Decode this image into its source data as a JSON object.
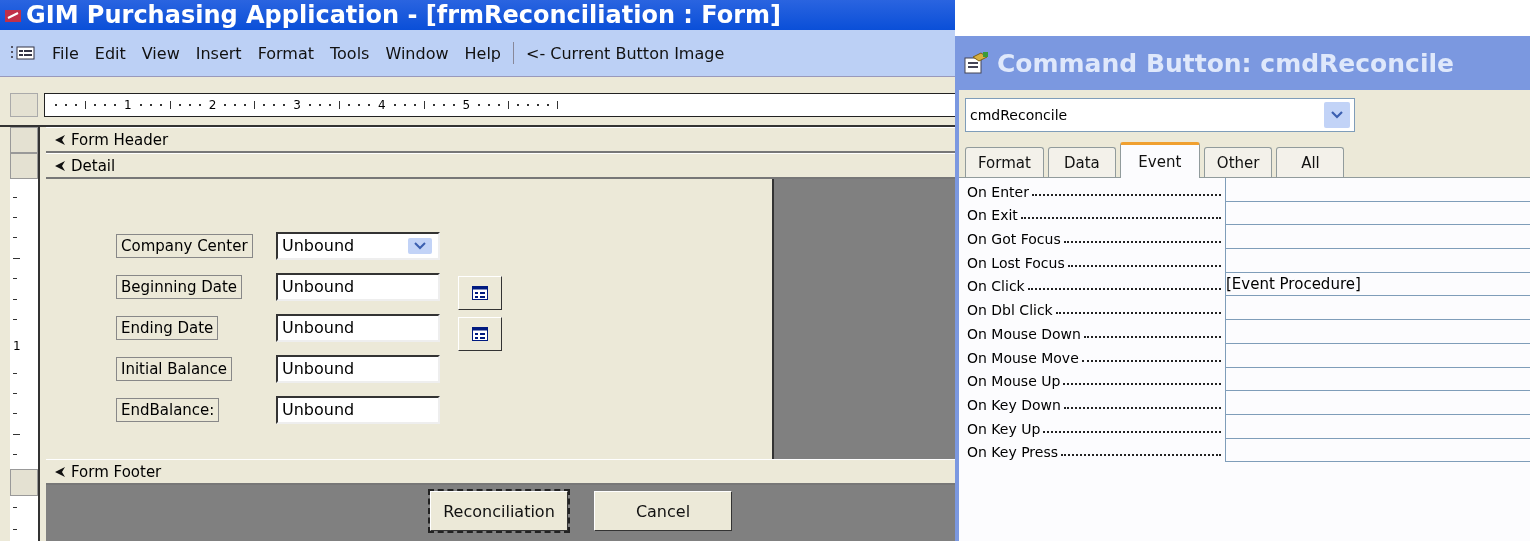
{
  "window": {
    "title": "GIM Purchasing Application - [frmReconciliation : Form]"
  },
  "menu": [
    {
      "label": "File"
    },
    {
      "label": "Edit"
    },
    {
      "label": "View"
    },
    {
      "label": "Insert"
    },
    {
      "label": "Format"
    },
    {
      "label": "Tools"
    },
    {
      "label": "Window"
    },
    {
      "label": "Help"
    }
  ],
  "toolbar_hint": "<- Current Button Image",
  "ruler": {
    "marks": [
      "1",
      "2",
      "3",
      "4",
      "5"
    ],
    "vertical_marks": [
      "1"
    ]
  },
  "sections": {
    "header": "Form Header",
    "detail": "Detail",
    "footer": "Form Footer"
  },
  "fields": [
    {
      "kind": "combo",
      "label": "Company Center",
      "value": "Unbound",
      "calendar": false
    },
    {
      "kind": "text",
      "label": "Beginning Date",
      "value": "Unbound",
      "calendar": true
    },
    {
      "kind": "text",
      "label": "Ending Date",
      "value": "Unbound",
      "calendar": true
    },
    {
      "kind": "text",
      "label": "Initial Balance",
      "value": "Unbound",
      "calendar": false
    },
    {
      "kind": "text",
      "label": "EndBalance:",
      "value": "Unbound",
      "calendar": false
    }
  ],
  "footer_buttons": [
    {
      "label": "Reconciliation",
      "selected": true
    },
    {
      "label": "Cancel",
      "selected": false
    }
  ],
  "property_sheet": {
    "title": "Command Button: cmdReconcile",
    "object": "cmdReconcile",
    "tabs": [
      {
        "label": "Format",
        "selected": false
      },
      {
        "label": "Data",
        "selected": false
      },
      {
        "label": "Event",
        "selected": true
      },
      {
        "label": "Other",
        "selected": false
      },
      {
        "label": "All",
        "selected": false
      }
    ],
    "properties": [
      {
        "name": "On Enter"
      },
      {
        "name": "On Exit"
      },
      {
        "name": "On Got Focus"
      },
      {
        "name": "On Lost Focus"
      },
      {
        "name": "On Click",
        "value": "[Event Procedure]"
      },
      {
        "name": "On Dbl Click"
      },
      {
        "name": "On Mouse Down"
      },
      {
        "name": "On Mouse Move"
      },
      {
        "name": "On Mouse Up"
      },
      {
        "name": "On Key Down"
      },
      {
        "name": "On Key Up"
      },
      {
        "name": "On Key Press"
      }
    ]
  }
}
